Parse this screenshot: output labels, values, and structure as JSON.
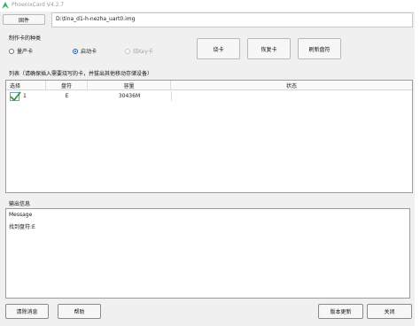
{
  "window": {
    "title": "PhoenixCard V4.2.7"
  },
  "firmware": {
    "button_label": "固件",
    "path": "D:\\tina_d1-h-nezha_uart0.img"
  },
  "card_type": {
    "group_label": "制作卡的种类",
    "options": [
      {
        "label": "量产卡",
        "selected": false,
        "enabled": true
      },
      {
        "label": "启动卡",
        "selected": true,
        "enabled": true
      },
      {
        "label": "烧Key卡",
        "selected": false,
        "enabled": false
      }
    ]
  },
  "actions": {
    "burn_label": "烧卡",
    "restore_label": "恢复卡",
    "refresh_label": "刷新盘符"
  },
  "list": {
    "label": "列表（请确保插入需要烧写的卡，并拔出其他移动存储设备）",
    "columns": [
      "选择",
      "盘符",
      "容量",
      "状态"
    ],
    "rows": [
      {
        "index": "1",
        "drive": "E",
        "capacity": "30436M",
        "status": "",
        "checked": true
      }
    ]
  },
  "output": {
    "label": "输出信息",
    "lines": [
      "Message",
      "找到盘符:E"
    ]
  },
  "footer": {
    "clear_label": "清除消息",
    "help_label": "帮助",
    "update_label": "版本更新",
    "close_label": "关闭"
  },
  "colors": {
    "accent": "#1a5fb4",
    "check": "#2e9e3a",
    "icon_green": "#3fae5a",
    "selection_border": "#7a9cc6"
  }
}
